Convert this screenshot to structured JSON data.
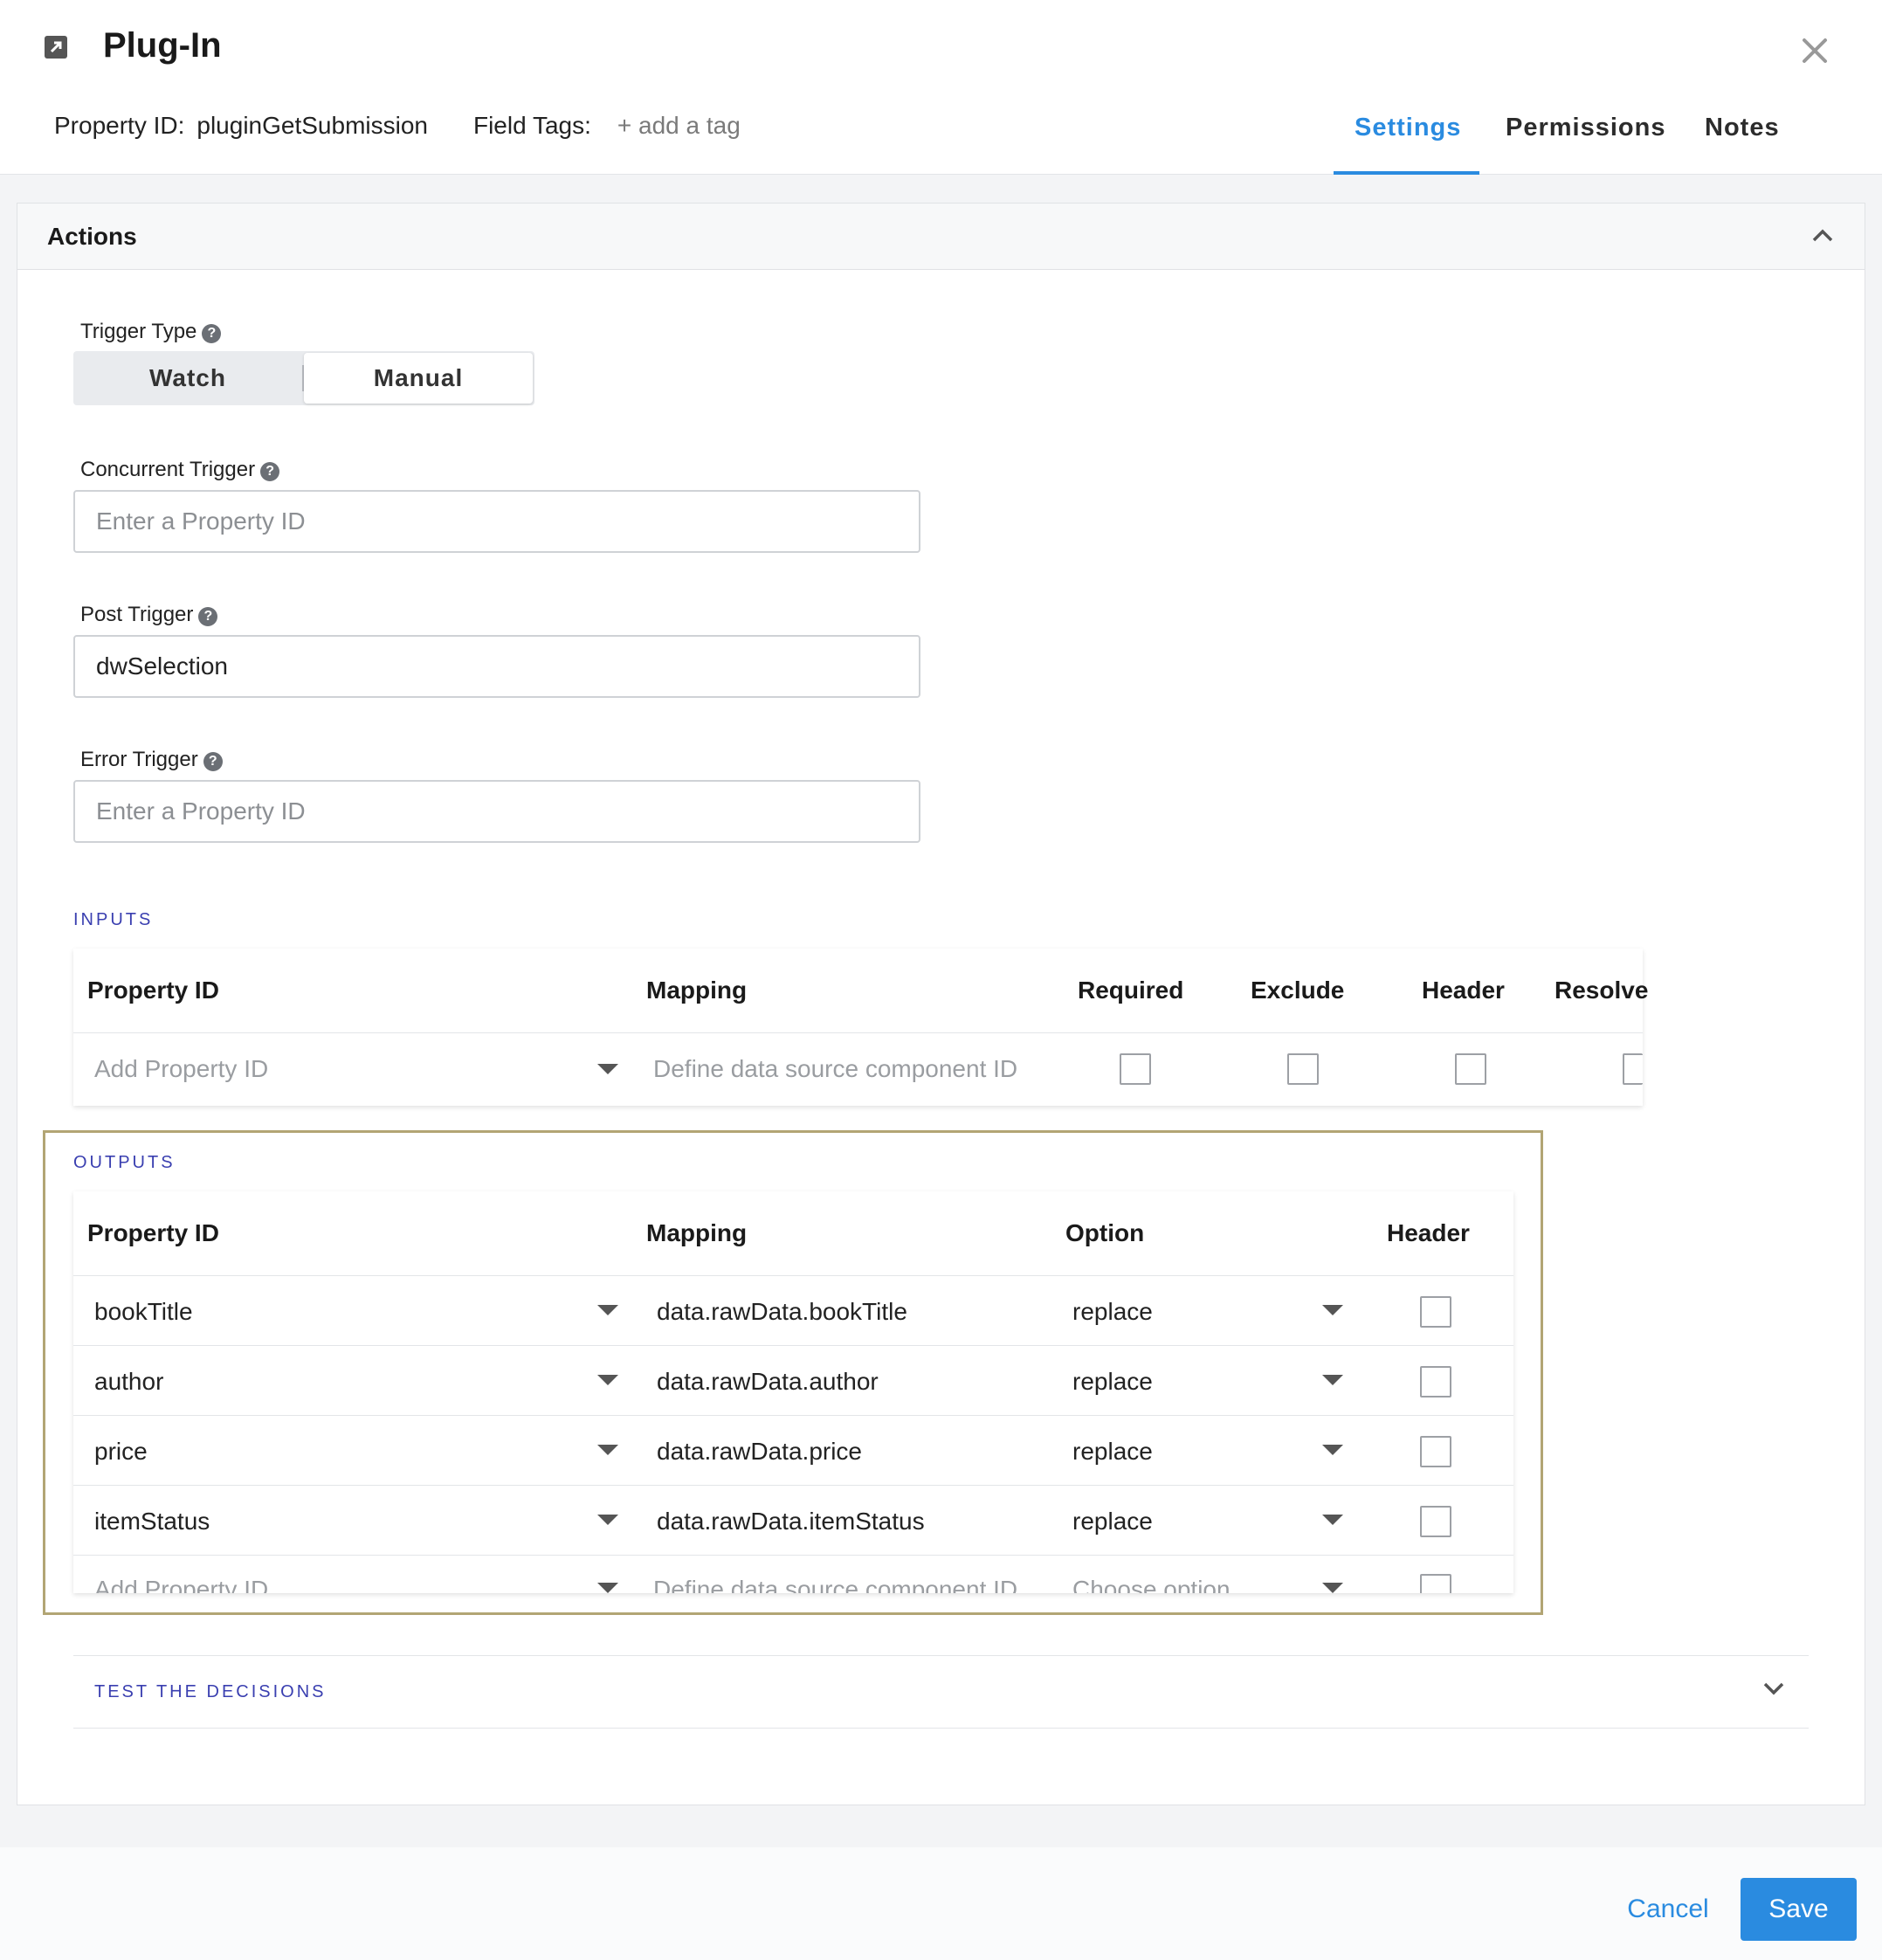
{
  "header": {
    "title": "Plug-In",
    "property_id_label": "Property ID:",
    "property_id_value": "pluginGetSubmission",
    "field_tags_label": "Field Tags:",
    "add_tag": "+ add a tag",
    "tabs": [
      {
        "label": "Settings",
        "active": true
      },
      {
        "label": "Permissions",
        "active": false
      },
      {
        "label": "Notes",
        "active": false
      }
    ]
  },
  "actions": {
    "title": "Actions",
    "trigger_type": {
      "label": "Trigger Type",
      "options": [
        "Watch",
        "Manual"
      ],
      "selected": "Manual"
    },
    "concurrent_trigger": {
      "label": "Concurrent Trigger",
      "value": "",
      "placeholder": "Enter a Property ID"
    },
    "post_trigger": {
      "label": "Post Trigger",
      "value": "dwSelection",
      "placeholder": "Enter a Property ID"
    },
    "error_trigger": {
      "label": "Error Trigger",
      "value": "",
      "placeholder": "Enter a Property ID"
    }
  },
  "inputs": {
    "caption": "INPUTS",
    "headers": [
      "Property ID",
      "Mapping",
      "Required",
      "Exclude",
      "Header",
      "Resolve"
    ],
    "new_row": {
      "property_placeholder": "Add Property ID",
      "mapping_placeholder": "Define data source component ID"
    }
  },
  "outputs": {
    "caption": "OUTPUTS",
    "headers": [
      "Property ID",
      "Mapping",
      "Option",
      "Header"
    ],
    "rows": [
      {
        "property": "bookTitle",
        "mapping": "data.rawData.bookTitle",
        "option": "replace",
        "header": false
      },
      {
        "property": "author",
        "mapping": "data.rawData.author",
        "option": "replace",
        "header": false
      },
      {
        "property": "price",
        "mapping": "data.rawData.price",
        "option": "replace",
        "header": false
      },
      {
        "property": "itemStatus",
        "mapping": "data.rawData.itemStatus",
        "option": "replace",
        "header": false
      }
    ],
    "new_row": {
      "property_placeholder": "Add Property ID",
      "mapping_placeholder": "Define data source component ID",
      "option_placeholder": "Choose option"
    }
  },
  "test_decisions": {
    "label": "TEST THE DECISIONS"
  },
  "footer": {
    "cancel": "Cancel",
    "save": "Save"
  },
  "colors": {
    "accent": "#2a8be0",
    "caption": "#3a3fb0",
    "highlight_frame": "#b2a574"
  }
}
